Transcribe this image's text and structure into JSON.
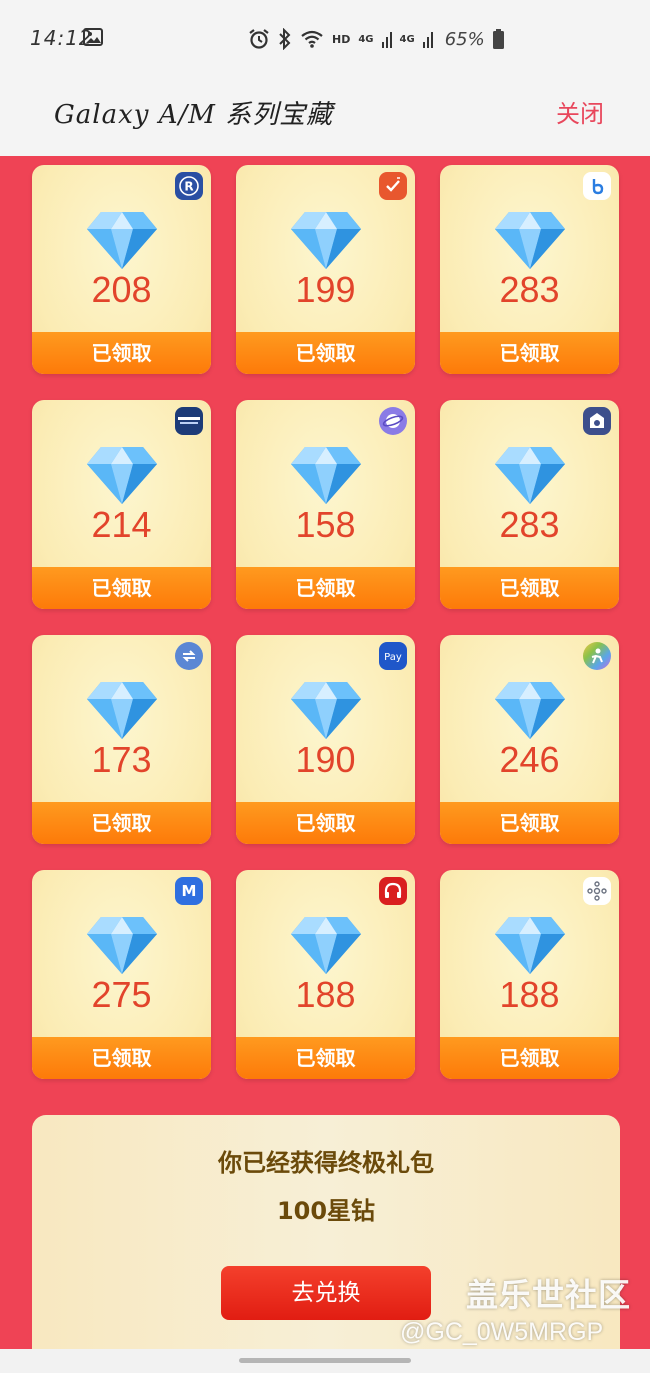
{
  "status_bar": {
    "time": "14:12",
    "hd": "HD",
    "sig1": "4G",
    "sig2": "4G",
    "battery": "65%"
  },
  "header": {
    "title": "Galaxy A/M 系列宝藏",
    "close_label": "关闭"
  },
  "cards": [
    {
      "value": "208",
      "status": "已领取",
      "icon": "rewards-app-icon",
      "badge_color": "#2a4fa3"
    },
    {
      "value": "199",
      "status": "已领取",
      "icon": "reminder-app-icon",
      "badge_color": "#e8572e"
    },
    {
      "value": "283",
      "status": "已领取",
      "icon": "bixby-app-icon",
      "badge_color": "#ffffff"
    },
    {
      "value": "214",
      "status": "已领取",
      "icon": "samsung-members-app-icon",
      "badge_color": "#1d3b78"
    },
    {
      "value": "158",
      "status": "已领取",
      "icon": "internet-browser-app-icon",
      "badge_color": "#8a7be6"
    },
    {
      "value": "283",
      "status": "已领取",
      "icon": "smartthings-find-app-icon",
      "badge_color": "#3d4f8c"
    },
    {
      "value": "173",
      "status": "已领取",
      "icon": "smart-switch-app-icon",
      "badge_color": "#5b87d4"
    },
    {
      "value": "190",
      "status": "已领取",
      "icon": "samsung-pay-app-icon",
      "badge_color": "#1f57c9"
    },
    {
      "value": "246",
      "status": "已领取",
      "icon": "health-app-icon",
      "badge_color": "#8ac24a"
    },
    {
      "value": "275",
      "status": "已领取",
      "icon": "samsung-m-app-icon",
      "badge_color": "#2f6fe0"
    },
    {
      "value": "188",
      "status": "已领取",
      "icon": "music-headphones-app-icon",
      "badge_color": "#d91f1f"
    },
    {
      "value": "188",
      "status": "已领取",
      "icon": "smartthings-app-icon",
      "badge_color": "#ffffff"
    }
  ],
  "final_panel": {
    "message": "你已经获得终极礼包",
    "reward": "100星钻",
    "button_label": "去兑换"
  },
  "watermark": {
    "line1": "盖乐世社区",
    "line2": "@GC_0W5MRGP"
  },
  "colors": {
    "background_red": "#ef4355",
    "card_status_orange": "#fd7a09",
    "value_red": "#e2442b",
    "exchange_button_red": "#e11d12"
  }
}
